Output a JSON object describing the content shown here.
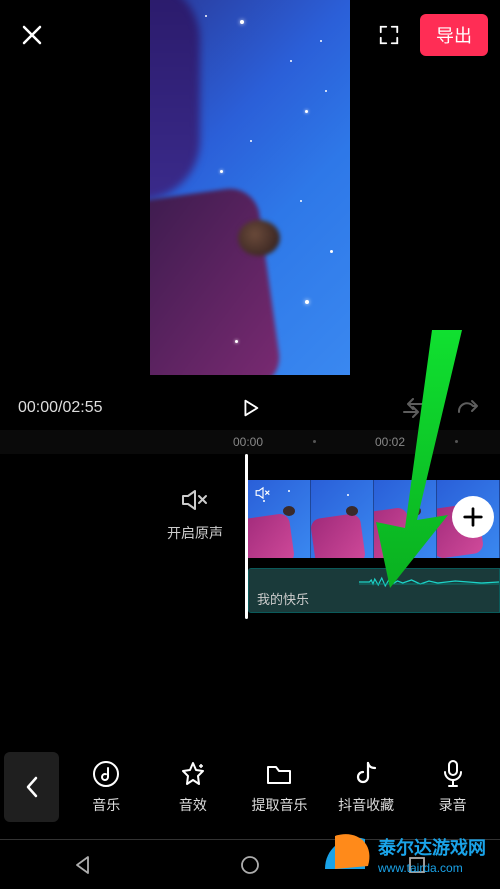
{
  "topbar": {
    "export_label": "导出"
  },
  "playback": {
    "current_time": "00:00",
    "total_time": "02:55",
    "combined": "00:00/02:55"
  },
  "ruler": {
    "t0": "00:00",
    "t1": "00:02"
  },
  "original_sound": {
    "label": "开启原声"
  },
  "audio_track": {
    "title": "我的快乐"
  },
  "toolbar": {
    "music": "音乐",
    "sfx": "音效",
    "extract": "提取音乐",
    "douyin_fav": "抖音收藏",
    "record": "录音"
  },
  "watermark": {
    "site1": "泰尔达游戏网",
    "site2": "www.tairda.com"
  }
}
